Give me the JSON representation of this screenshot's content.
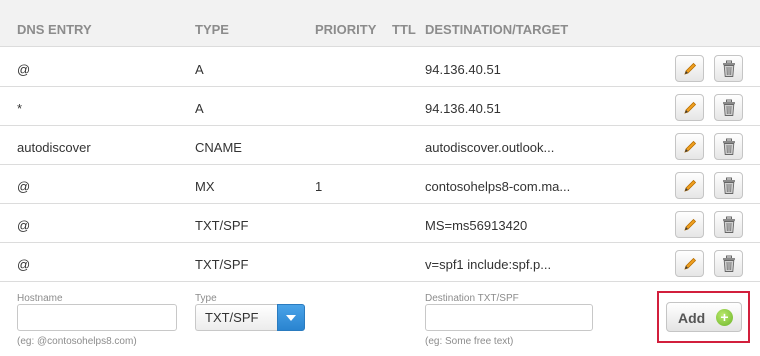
{
  "headers": {
    "dns_entry": "DNS ENTRY",
    "type": "TYPE",
    "priority": "PRIORITY",
    "ttl": "TTL",
    "destination": "DESTINATION/TARGET"
  },
  "records": [
    {
      "entry": "@",
      "type": "A",
      "priority": "",
      "ttl": "",
      "destination": "94.136.40.51"
    },
    {
      "entry": "*",
      "type": "A",
      "priority": "",
      "ttl": "",
      "destination": "94.136.40.51"
    },
    {
      "entry": "autodiscover",
      "type": "CNAME",
      "priority": "",
      "ttl": "",
      "destination": "autodiscover.outlook..."
    },
    {
      "entry": "@",
      "type": "MX",
      "priority": "1",
      "ttl": "",
      "destination": "contosohelps8-com.ma..."
    },
    {
      "entry": "@",
      "type": "TXT/SPF",
      "priority": "",
      "ttl": "",
      "destination": "MS=ms56913420"
    },
    {
      "entry": "@",
      "type": "TXT/SPF",
      "priority": "",
      "ttl": "",
      "destination": "v=spf1 include:spf.p..."
    }
  ],
  "row_actions": {
    "edit_icon": "pencil-icon",
    "delete_icon": "trash-icon"
  },
  "form": {
    "hostname_label": "Hostname",
    "hostname_value": "",
    "hostname_hint": "(eg: @contosohelps8.com)",
    "type_label": "Type",
    "type_value": "TXT/SPF",
    "destination_label": "Destination TXT/SPF",
    "destination_value": "",
    "destination_hint": "(eg: Some free text)",
    "add_label": "Add",
    "add_icon": "plus-circle-icon"
  },
  "colors": {
    "header_bg": "#f2f2f2",
    "header_text": "#8c8c8c",
    "highlight_border": "#d21f3c",
    "select_arrow": "#2a84d0",
    "add_icon": "#6cb52a"
  }
}
